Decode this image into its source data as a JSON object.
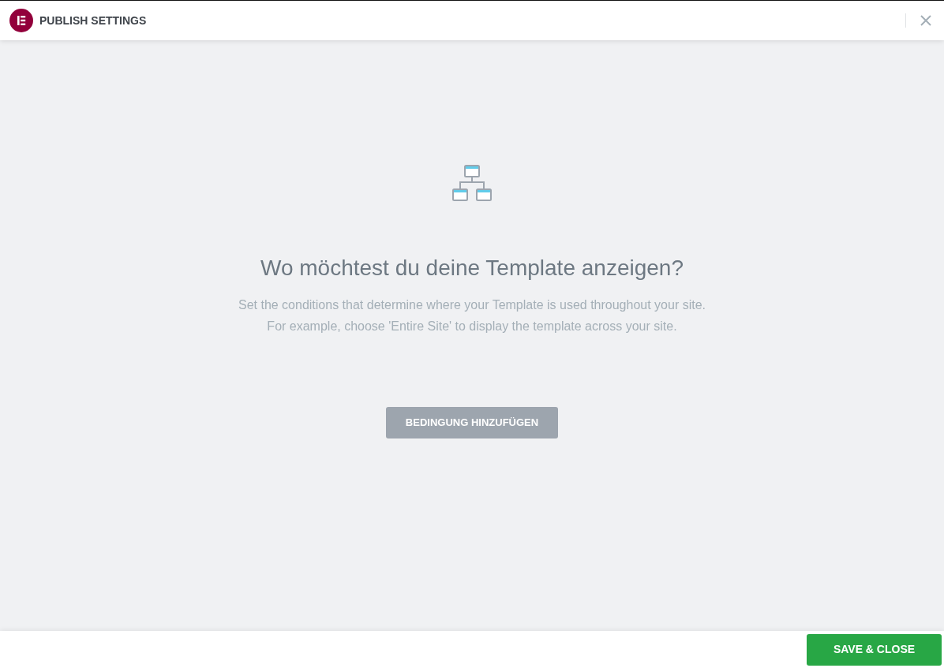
{
  "header": {
    "title": "PUBLISH SETTINGS"
  },
  "content": {
    "heading": "Wo möchtest du deine Template anzeigen?",
    "description": [
      "Set the conditions that determine where your Template is used throughout your site.",
      "For example, choose 'Entire Site' to display the template across your site."
    ],
    "add_button": "BEDINGUNG HINZUFÜGEN"
  },
  "footer": {
    "save_button": "SAVE & CLOSE"
  }
}
